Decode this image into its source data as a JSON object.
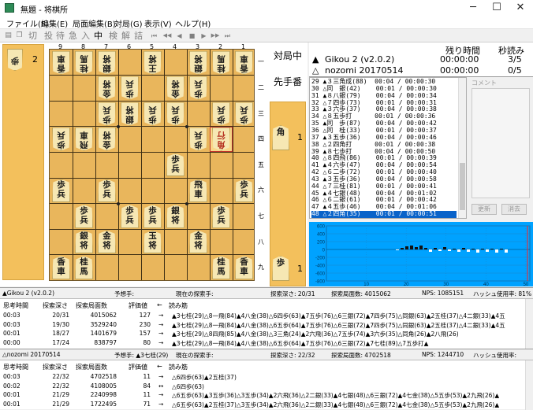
{
  "window": {
    "title": "無題 - 将棋所",
    "minimize": "─",
    "maximize": "☐",
    "close": "✕"
  },
  "menu": [
    "ファイル(F)",
    "編集(E)",
    "局面編集(B)",
    "対局(G)",
    "表示(V)",
    "ヘルプ(H)"
  ],
  "toolbar": {
    "icons": [
      "floppy-icon",
      "copy-icon",
      "cut-icon"
    ],
    "buttons": [
      "切",
      "投",
      "待",
      "急",
      "入",
      "中",
      "検",
      "解",
      "詰"
    ],
    "nav": [
      "⏮",
      "◀◀",
      "◀◀",
      "◀",
      "■",
      "▶",
      "▶▶",
      "▶▶",
      "⏭"
    ]
  },
  "board": {
    "file_labels": [
      "9",
      "8",
      "7",
      "6",
      "5",
      "4",
      "3",
      "2",
      "1"
    ],
    "rank_labels": [
      "一",
      "二",
      "三",
      "四",
      "五",
      "六",
      "七",
      "八",
      "九"
    ],
    "gote_hand": {
      "piece": "歩",
      "count": "2"
    },
    "sente_hand": [
      {
        "piece": "角",
        "count": "1"
      },
      {
        "piece": "歩",
        "count": "1"
      }
    ],
    "status": "対局中",
    "turn": "先手番",
    "pieces": [
      {
        "f": 9,
        "r": 1,
        "p": "香車",
        "o": "w"
      },
      {
        "f": 8,
        "r": 1,
        "p": "桂馬",
        "o": "w"
      },
      {
        "f": 7,
        "r": 1,
        "p": "銀将",
        "o": "w"
      },
      {
        "f": 5,
        "r": 1,
        "p": "王将",
        "o": "w"
      },
      {
        "f": 3,
        "r": 1,
        "p": "銀将",
        "o": "w"
      },
      {
        "f": 2,
        "r": 1,
        "p": "桂馬",
        "o": "w"
      },
      {
        "f": 1,
        "r": 1,
        "p": "香車",
        "o": "w"
      },
      {
        "f": 7,
        "r": 2,
        "p": "金将",
        "o": "w"
      },
      {
        "f": 6,
        "r": 2,
        "p": "歩兵",
        "o": "w"
      },
      {
        "f": 4,
        "r": 2,
        "p": "金将",
        "o": "w"
      },
      {
        "f": 3,
        "r": 2,
        "p": "歩兵",
        "o": "w"
      },
      {
        "f": 7,
        "r": 3,
        "p": "歩兵",
        "o": "w"
      },
      {
        "f": 6,
        "r": 3,
        "p": "銀将",
        "o": "w"
      },
      {
        "f": 5,
        "r": 3,
        "p": "歩兵",
        "o": "w"
      },
      {
        "f": 4,
        "r": 3,
        "p": "歩兵",
        "o": "w"
      },
      {
        "f": 2,
        "r": 3,
        "p": "歩兵",
        "o": "w"
      },
      {
        "f": 1,
        "r": 3,
        "p": "歩兵",
        "o": "w"
      },
      {
        "f": 9,
        "r": 4,
        "p": "歩兵",
        "o": "w"
      },
      {
        "f": 8,
        "r": 4,
        "p": "飛車",
        "o": "w"
      },
      {
        "f": 7,
        "r": 4,
        "p": "金将",
        "o": "w"
      },
      {
        "f": 3,
        "r": 4,
        "p": "歩兵",
        "o": "w"
      },
      {
        "f": 2,
        "r": 4,
        "p": "角行",
        "o": "w",
        "hl": true
      },
      {
        "f": 4,
        "r": 5,
        "p": "歩兵",
        "o": "b"
      },
      {
        "f": 9,
        "r": 6,
        "p": "歩兵",
        "o": "b"
      },
      {
        "f": 7,
        "r": 6,
        "p": "歩兵",
        "o": "b"
      },
      {
        "f": 3,
        "r": 6,
        "p": "飛車",
        "o": "b"
      },
      {
        "f": 1,
        "r": 6,
        "p": "歩兵",
        "o": "b"
      },
      {
        "f": 8,
        "r": 7,
        "p": "歩兵",
        "o": "b"
      },
      {
        "f": 6,
        "r": 7,
        "p": "歩兵",
        "o": "b"
      },
      {
        "f": 5,
        "r": 7,
        "p": "歩兵",
        "o": "b"
      },
      {
        "f": 4,
        "r": 7,
        "p": "銀将",
        "o": "b"
      },
      {
        "f": 2,
        "r": 7,
        "p": "歩兵",
        "o": "b"
      },
      {
        "f": 8,
        "r": 8,
        "p": "銀将",
        "o": "b"
      },
      {
        "f": 7,
        "r": 8,
        "p": "金将",
        "o": "b"
      },
      {
        "f": 5,
        "r": 8,
        "p": "玉将",
        "o": "b"
      },
      {
        "f": 3,
        "r": 8,
        "p": "金将",
        "o": "b"
      },
      {
        "f": 9,
        "r": 9,
        "p": "香車",
        "o": "b"
      },
      {
        "f": 8,
        "r": 9,
        "p": "桂馬",
        "o": "b"
      },
      {
        "f": 2,
        "r": 9,
        "p": "桂馬",
        "o": "b"
      },
      {
        "f": 1,
        "r": 9,
        "p": "香車",
        "o": "b"
      }
    ]
  },
  "info": {
    "remain_label": "残り時間",
    "byoyomi_label": "秒読み",
    "sente_mark": "▲",
    "sente_name": "Gikou 2 (v2.0.2)",
    "sente_time": "00:00:00",
    "sente_byo": "3/5",
    "gote_mark": "△",
    "gote_name": "nozomi 20170514",
    "gote_time": "00:00:00",
    "gote_byo": "0/5"
  },
  "kifu": [
    "29 ▲３三角成(88)  00:04 / 00:00:30",
    "30 △同　銀(42)    00:01 / 00:00:30",
    "31 ▲８八銀(79)    00:04 / 00:00:34",
    "32 △７四歩(73)    00:01 / 00:00:31",
    "33 ▲３六歩(37)    00:04 / 00:00:38",
    "34 △８五歩打      00:01 / 00:00:36",
    "35 ▲同　歩(87)    00:04 / 00:00:42",
    "36 △同　桂(33)    00:01 / 00:00:37",
    "37 ▲３五歩(36)    00:04 / 00:00:46",
    "38 △２四角打      00:01 / 00:00:38",
    "39 ▲８七歩打      00:04 / 00:00:50",
    "40 △８四飛(86)    00:01 / 00:00:39",
    "41 ▲４六歩(47)    00:04 / 00:00:54",
    "42 △６二歩(72)    00:01 / 00:00:40",
    "43 ▲３五歩(36)    00:04 / 00:00:58",
    "44 △７三桂(81)    00:01 / 00:00:41",
    "45 ▲４七銀(48)    00:04 / 00:01:02",
    "46 △６二銀(61)    00:01 / 00:00:42",
    "47 ▲４五歩(46)    00:04 / 00:01:06",
    "48 △２四角(35)    00:01 / 00:00:51"
  ],
  "comment": {
    "title": "コメント",
    "update": "更新",
    "clear": "消去"
  },
  "graph": {
    "yticks": [
      "600",
      "400",
      "200",
      "0",
      "-200",
      "-400",
      "-600",
      "-800"
    ],
    "xticks": [
      "10",
      "20",
      "30",
      "40",
      "50"
    ]
  },
  "engine1": {
    "header": [
      "▲Gikou 2 (v2.0.2)",
      "予想手:",
      "現在の探索手:",
      "探索深さ: 20/31",
      "探索局面数: 4015062",
      "NPS: 1085151",
      "ハッシュ使用率: 81%"
    ],
    "cols": [
      "思考時間",
      "探索深さ",
      "探索局面数",
      "評価値",
      "←",
      "読み筋"
    ],
    "rows": [
      [
        "00:03",
        "20/31",
        "4015062",
        "127",
        "→",
        "▲3七桂(29)△8一飛(84)▲4八金(38)△6四歩(63)▲7五歩(76)△6三銀(72)▲7四歩(75)△同銀(63)▲2五桂(37)△4二銀(33)▲4五"
      ],
      [
        "00:03",
        "19/30",
        "3529240",
        "230",
        "→",
        "▲3七桂(29)△8一飛(84)▲4八金(38)△6五歩(64)▲7五歩(76)△6三銀(72)▲7四歩(75)△同銀(63)▲2五桂(37)△4二銀(33)▲4五"
      ],
      [
        "00:01",
        "18/27",
        "1401679",
        "157",
        "→",
        "▲3七桂(29)△8四飛(85)▲4八金(38)△3三角(24)▲2六飛(36)△7五歩(74)▲3六歩(35)△同角(26)▲2八飛(26)"
      ],
      [
        "00:00",
        "17/24",
        "838797",
        "80",
        "→",
        "▲3七桂(29)△8一飛(84)▲4八金(38)△6五歩(64)▲7五歩(76)△6三銀(72)▲7七桂(89)△7五歩打▲"
      ]
    ]
  },
  "engine2": {
    "header": [
      "△nozomi 20170514",
      "予想手: ▲3七桂(29)",
      "現在の探索手:",
      "探索深さ: 22/32",
      "探索局面数: 4702518",
      "NPS: 1244710",
      "ハッシュ使用率:"
    ],
    "cols": [
      "思考時間",
      "探索深さ",
      "探索局面数",
      "評価値",
      "←",
      "読み筋"
    ],
    "rows": [
      [
        "00:03",
        "22/32",
        "4702518",
        "11",
        "→",
        "△6四歩(63)▲2五桂(37)"
      ],
      [
        "00:02",
        "22/32",
        "4108005",
        "84",
        "↔",
        "△6四歩(63)"
      ],
      [
        "00:01",
        "21/29",
        "2240998",
        "11",
        "→",
        "△6五歩(63)▲3五歩(36)△3五歩(34)▲2六飛(36)△2二銀(33)▲4七銀(48)△6三銀(72)▲4七金(38)△5五歩(53)▲2九飛(26)▲"
      ],
      [
        "00:01",
        "21/29",
        "1722495",
        "71",
        "→",
        "△6五歩(63)▲2五桂(37)△3五歩(34)▲2六飛(36)△2二銀(33)▲4七銀(48)△6三銀(72)▲4七金(38)△5五歩(53)▲2九飛(26)▲"
      ]
    ]
  }
}
